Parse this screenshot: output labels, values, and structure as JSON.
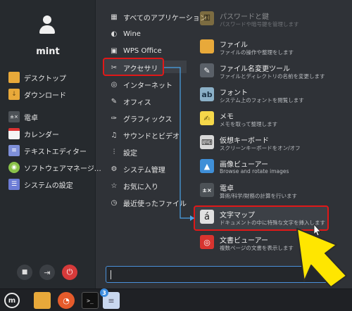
{
  "user": {
    "name": "mint"
  },
  "favorites": [
    {
      "label": "デスクトップ",
      "icon": "folder-icon",
      "color": "#e8a93a"
    },
    {
      "label": "ダウンロード",
      "icon": "download-folder-icon",
      "color": "#e8a93a"
    },
    {
      "label": "電卓",
      "icon": "calculator-icon",
      "color": "#4d5257"
    },
    {
      "label": "カレンダー",
      "icon": "calendar-icon",
      "color": "#f4f4f4"
    },
    {
      "label": "テキストエディター",
      "icon": "text-editor-icon",
      "color": "#7e8fd8"
    },
    {
      "label": "ソフトウェアマネージ…",
      "icon": "software-manager-icon",
      "color": "#8ac249"
    },
    {
      "label": "システムの設定",
      "icon": "settings-icon",
      "color": "#6c7cd6"
    }
  ],
  "categories": [
    {
      "label": "すべてのアプリケーション",
      "icon": "grid-icon"
    },
    {
      "label": "Wine",
      "icon": "wine-icon"
    },
    {
      "label": "WPS Office",
      "icon": "wps-icon"
    },
    {
      "label": "アクセサリ",
      "icon": "accessories-icon"
    },
    {
      "label": "インターネット",
      "icon": "globe-icon"
    },
    {
      "label": "オフィス",
      "icon": "office-icon"
    },
    {
      "label": "グラフィックス",
      "icon": "graphics-icon"
    },
    {
      "label": "サウンドとビデオ",
      "icon": "media-icon"
    },
    {
      "label": "設定",
      "icon": "sliders-icon"
    },
    {
      "label": "システム管理",
      "icon": "gear-icon"
    },
    {
      "label": "お気に入り",
      "icon": "star-icon"
    },
    {
      "label": "最近使ったファイル",
      "icon": "clock-icon"
    }
  ],
  "apps": [
    {
      "name": "パスワードと鍵",
      "desc": "パスワードや暗号鍵を管理します",
      "icon": "password-icon",
      "color": "#c9a64b"
    },
    {
      "name": "ファイル",
      "desc": "ファイルの操作や整理をします",
      "icon": "folder-icon",
      "color": "#e8a93a"
    },
    {
      "name": "ファイル名変更ツール",
      "desc": "ファイルとディレクトリの名前を変更します",
      "icon": "rename-icon",
      "color": "#5a6068"
    },
    {
      "name": "フォント",
      "desc": "システム上のフォントを閲覧します",
      "icon": "font-icon",
      "color": "#8bb0c7"
    },
    {
      "name": "メモ",
      "desc": "メモを取って整理します",
      "icon": "notes-icon",
      "color": "#f5d84a"
    },
    {
      "name": "仮想キーボード",
      "desc": "スクリーンキーボードをオン/オフ",
      "icon": "keyboard-icon",
      "color": "#d8d8d8"
    },
    {
      "name": "画像ビューアー",
      "desc": "Browse and rotate images",
      "icon": "image-viewer-icon",
      "color": "#3f8fd8"
    },
    {
      "name": "電卓",
      "desc": "算術/科学/財務の計算を行います",
      "icon": "calculator-icon",
      "color": "#4d5257"
    },
    {
      "name": "文字マップ",
      "desc": "ドキュメントの中に特殊な文字を挿入します",
      "icon": "character-map-icon",
      "color": "#e0e0e0"
    },
    {
      "name": "文書ビューアー",
      "desc": "複数ページの文書を表示します",
      "icon": "document-viewer-icon",
      "color": "#d8342f"
    }
  ],
  "taskbar": {
    "badge": "3"
  },
  "glyphs": {
    "font": "ab",
    "char_map": "á",
    "calc": "+−\n×=",
    "lock": "🔒",
    "logout": "⏏",
    "power": "⏻"
  }
}
